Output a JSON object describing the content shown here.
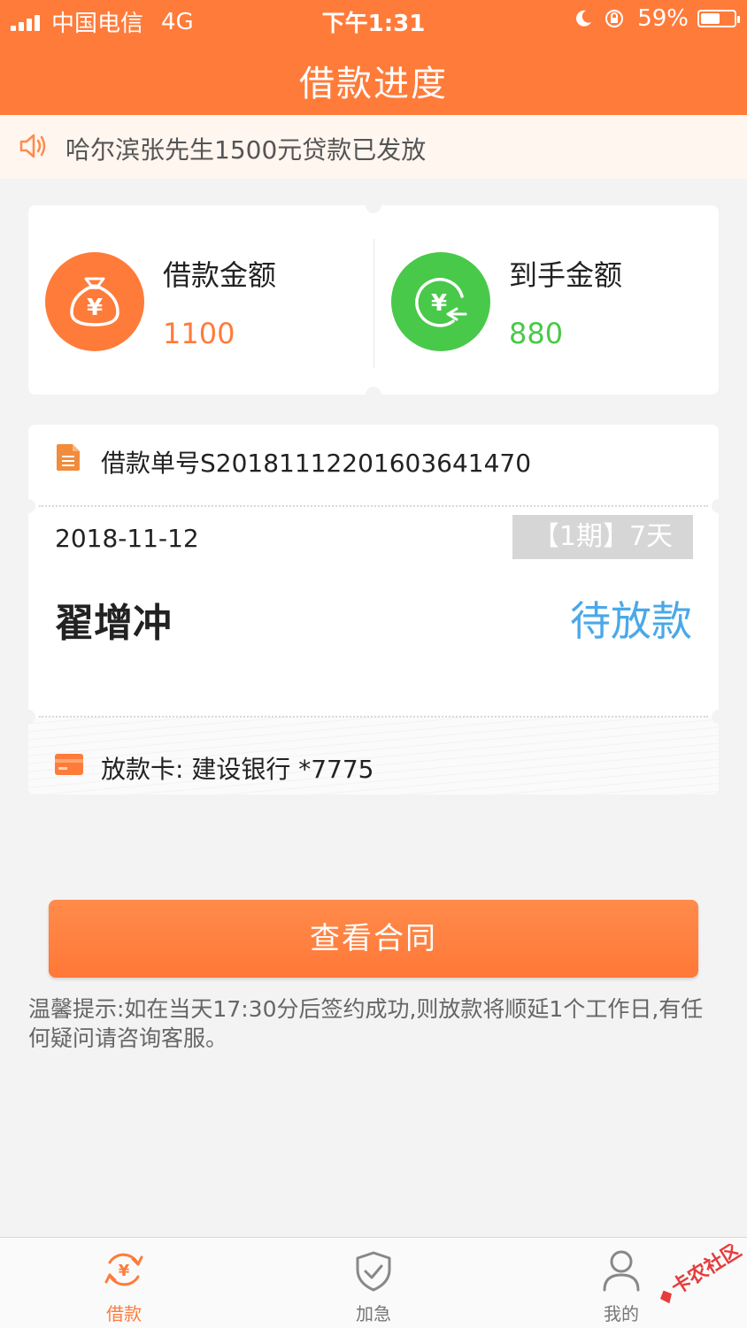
{
  "status_bar": {
    "carrier": "中国电信",
    "network": "4G",
    "time": "下午1:31",
    "battery_percent": "59%",
    "battery_level": 0.59
  },
  "header": {
    "title": "借款进度"
  },
  "notice": {
    "text": "哈尔滨张先生1500元贷款已发放",
    "icon": "speaker-icon"
  },
  "amounts": {
    "loan_label": "借款金额",
    "loan_value": "1100",
    "received_label": "到手金额",
    "received_value": "880",
    "loan_color": "#ff7b3a",
    "received_color": "#49c94a"
  },
  "order": {
    "number_text": "借款单号S20181112201603641470",
    "date": "2018-11-12",
    "period": "【1期】7天",
    "borrower": "翟增冲",
    "status": "待放款",
    "card_text": "放款卡: 建设银行 *7775"
  },
  "actions": {
    "view_contract": "查看合同"
  },
  "tip": {
    "text": "温馨提示:如在当天17:30分后签约成功,则放款将顺延1个工作日,有任何疑问请咨询客服。"
  },
  "bottom_nav": {
    "items": [
      {
        "label": "借款",
        "icon": "yuan-refresh-icon",
        "active": true
      },
      {
        "label": "加急",
        "icon": "shield-check-icon",
        "active": false
      },
      {
        "label": "我的",
        "icon": "person-icon",
        "active": false
      }
    ]
  },
  "watermark": {
    "text": "卡农社区"
  }
}
